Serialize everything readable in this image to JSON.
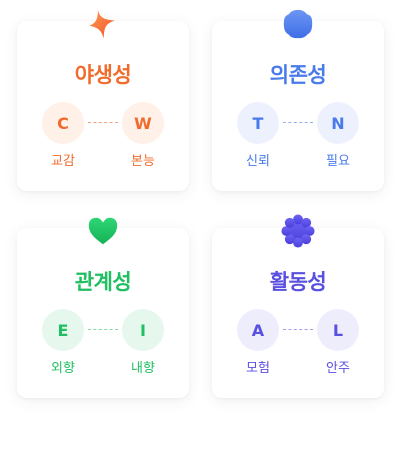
{
  "cards": [
    {
      "title": "야생성",
      "icon": "sparkle-icon",
      "color": "#f06b2c",
      "left": {
        "letter": "C",
        "label": "교감"
      },
      "right": {
        "letter": "W",
        "label": "본능"
      }
    },
    {
      "title": "의존성",
      "icon": "blob-icon",
      "color": "#4a7bea",
      "left": {
        "letter": "T",
        "label": "신뢰"
      },
      "right": {
        "letter": "N",
        "label": "필요"
      }
    },
    {
      "title": "관계성",
      "icon": "heart-icon",
      "color": "#1fbf62",
      "left": {
        "letter": "E",
        "label": "외향"
      },
      "right": {
        "letter": "I",
        "label": "내향"
      }
    },
    {
      "title": "활동성",
      "icon": "scallop-flower-icon",
      "color": "#5a50e0",
      "left": {
        "letter": "A",
        "label": "모험"
      },
      "right": {
        "letter": "L",
        "label": "안주"
      }
    }
  ]
}
